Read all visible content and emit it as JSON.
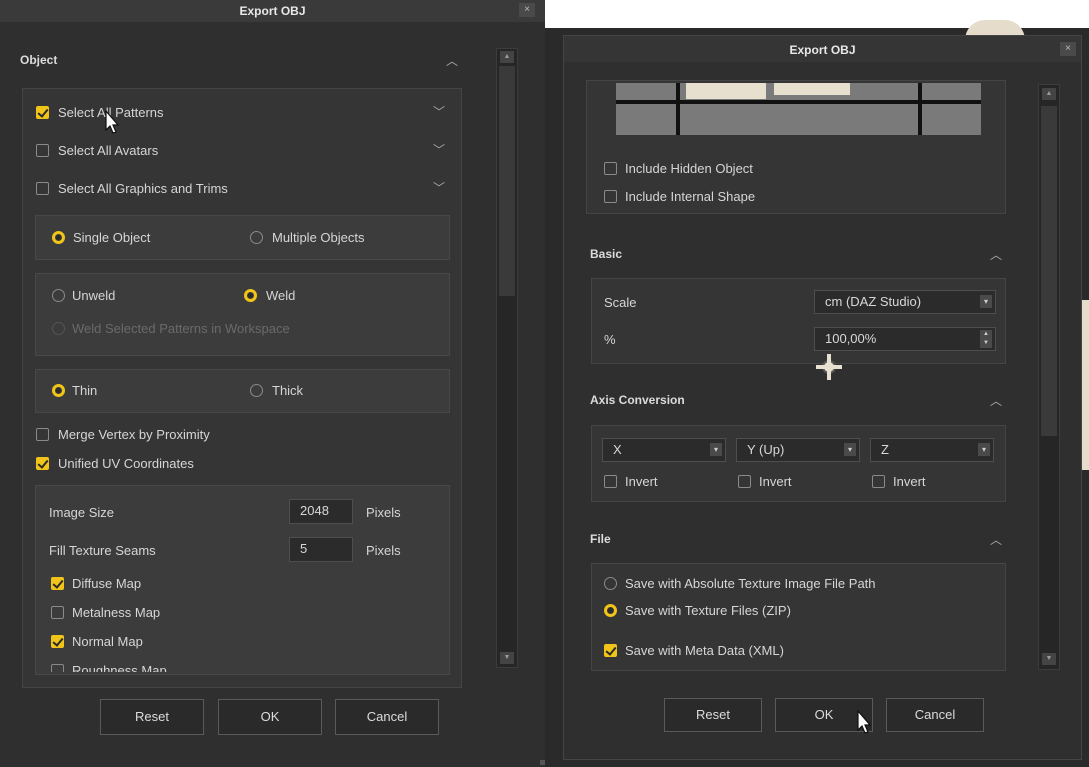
{
  "left": {
    "title": "Export OBJ",
    "close": "×",
    "section_object": "Object",
    "select_all_patterns": "Select All Patterns",
    "select_all_avatars": "Select All Avatars",
    "select_all_graphics": "Select All Graphics and Trims",
    "single_object": "Single Object",
    "multiple_objects": "Multiple Objects",
    "unweld": "Unweld",
    "weld": "Weld",
    "weld_selected": "Weld Selected Patterns in Workspace",
    "thin": "Thin",
    "thick": "Thick",
    "merge_vertex": "Merge Vertex by Proximity",
    "unified_uv": "Unified UV Coordinates",
    "image_size_label": "Image Size",
    "image_size_value": "2048",
    "pixels_1": "Pixels",
    "fill_seams_label": "Fill Texture Seams",
    "fill_seams_value": "5",
    "pixels_2": "Pixels",
    "diffuse_map": "Diffuse Map",
    "metalness_map": "Metalness Map",
    "normal_map": "Normal Map",
    "roughness_map": "Roughness Map",
    "reset": "Reset",
    "ok": "OK",
    "cancel": "Cancel"
  },
  "right": {
    "title": "Export OBJ",
    "close": "×",
    "include_hidden": "Include Hidden Object",
    "include_internal": "Include Internal Shape",
    "section_basic": "Basic",
    "scale_label": "Scale",
    "scale_value": "cm (DAZ Studio)",
    "percent_label": "%",
    "percent_value": "100,00%",
    "section_axis": "Axis Conversion",
    "axis_x": "X",
    "axis_y": "Y (Up)",
    "axis_z": "Z",
    "invert_1": "Invert",
    "invert_2": "Invert",
    "invert_3": "Invert",
    "section_file": "File",
    "save_absolute": "Save with Absolute Texture Image File Path",
    "save_zip": "Save with Texture Files (ZIP)",
    "save_meta": "Save with Meta Data (XML)",
    "reset": "Reset",
    "ok": "OK",
    "cancel": "Cancel"
  }
}
